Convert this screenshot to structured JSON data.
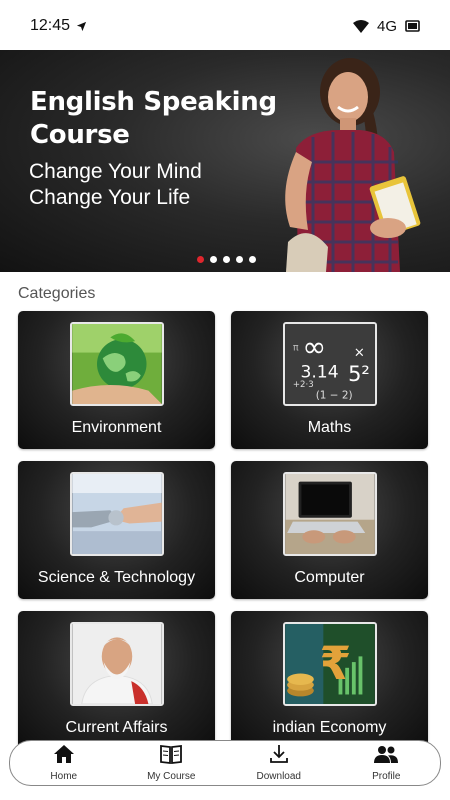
{
  "status_bar": {
    "time": "12:45",
    "network": "4G"
  },
  "banner": {
    "title": "English Speaking Course",
    "subtitle": "Change Your Mind Change Your Life",
    "slides": 5,
    "active_slide": 1,
    "accent": "#e0262d"
  },
  "categories": {
    "heading": "Categories",
    "items": [
      {
        "label": "Environment",
        "icon": "globe-leaf-image"
      },
      {
        "label": "Maths",
        "icon": "math-formula-image"
      },
      {
        "label": "Science & Technology",
        "icon": "robot-handshake-image"
      },
      {
        "label": "Computer",
        "icon": "laptop-image"
      },
      {
        "label": "Current Affairs",
        "icon": "portrait-image"
      },
      {
        "label": "indian Economy",
        "icon": "rupee-coins-image"
      }
    ]
  },
  "bottom_nav": {
    "items": [
      {
        "label": "Home",
        "icon": "home-icon"
      },
      {
        "label": "My Course",
        "icon": "book-icon"
      },
      {
        "label": "Download",
        "icon": "download-icon"
      },
      {
        "label": "Profile",
        "icon": "people-icon"
      }
    ]
  }
}
